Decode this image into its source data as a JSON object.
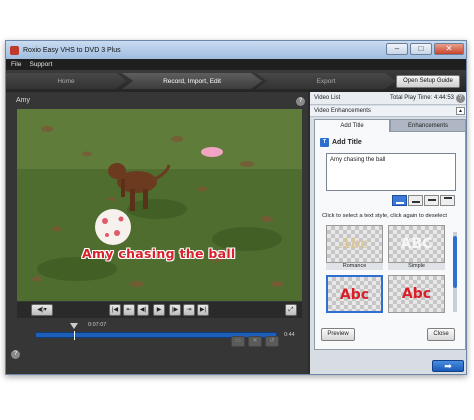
{
  "window": {
    "title": "Roxio Easy VHS to DVD 3 Plus",
    "controls": {
      "minimize": "–",
      "maximize": "□",
      "close": "✕"
    }
  },
  "menu": [
    "File",
    "Support"
  ],
  "steps": {
    "home": "Home",
    "record": "Record, Import, Edit",
    "export": "Export"
  },
  "open_setup_label": "Open Setup Guide",
  "video": {
    "label": "Amy",
    "caption": "Amy chasing the ball"
  },
  "timeline": {
    "current_time": "0:07:07",
    "end_time": "0:44",
    "position_fraction": 0.16
  },
  "right_panel": {
    "video_list_label": "Video List",
    "total_play_time": "Total Play Time: 4:44:53",
    "enhancements_label": "Video Enhancements",
    "tabs": [
      "Add Title",
      "Enhancements"
    ],
    "add_title_heading": "Add Title",
    "title_input_value": "Amy chasing the ball",
    "style_hint": "Click to select a text style, click again to deselect",
    "styles": [
      {
        "sample": "Abc",
        "name": "Romance",
        "color": "#d9c79a"
      },
      {
        "sample": "ABC",
        "name": "Simple",
        "color": "#f0f0f0"
      },
      {
        "sample": "Abc",
        "name": "",
        "color": "#d8202a"
      },
      {
        "sample": "Abc",
        "name": "",
        "color": "#d8202a"
      }
    ],
    "preview_label": "Preview",
    "close_label": "Close"
  },
  "icons": {
    "help": "?",
    "next": "➡",
    "collapse": "▲"
  },
  "colors": {
    "accent": "#2f6fd1",
    "caption": "#d8202a"
  }
}
